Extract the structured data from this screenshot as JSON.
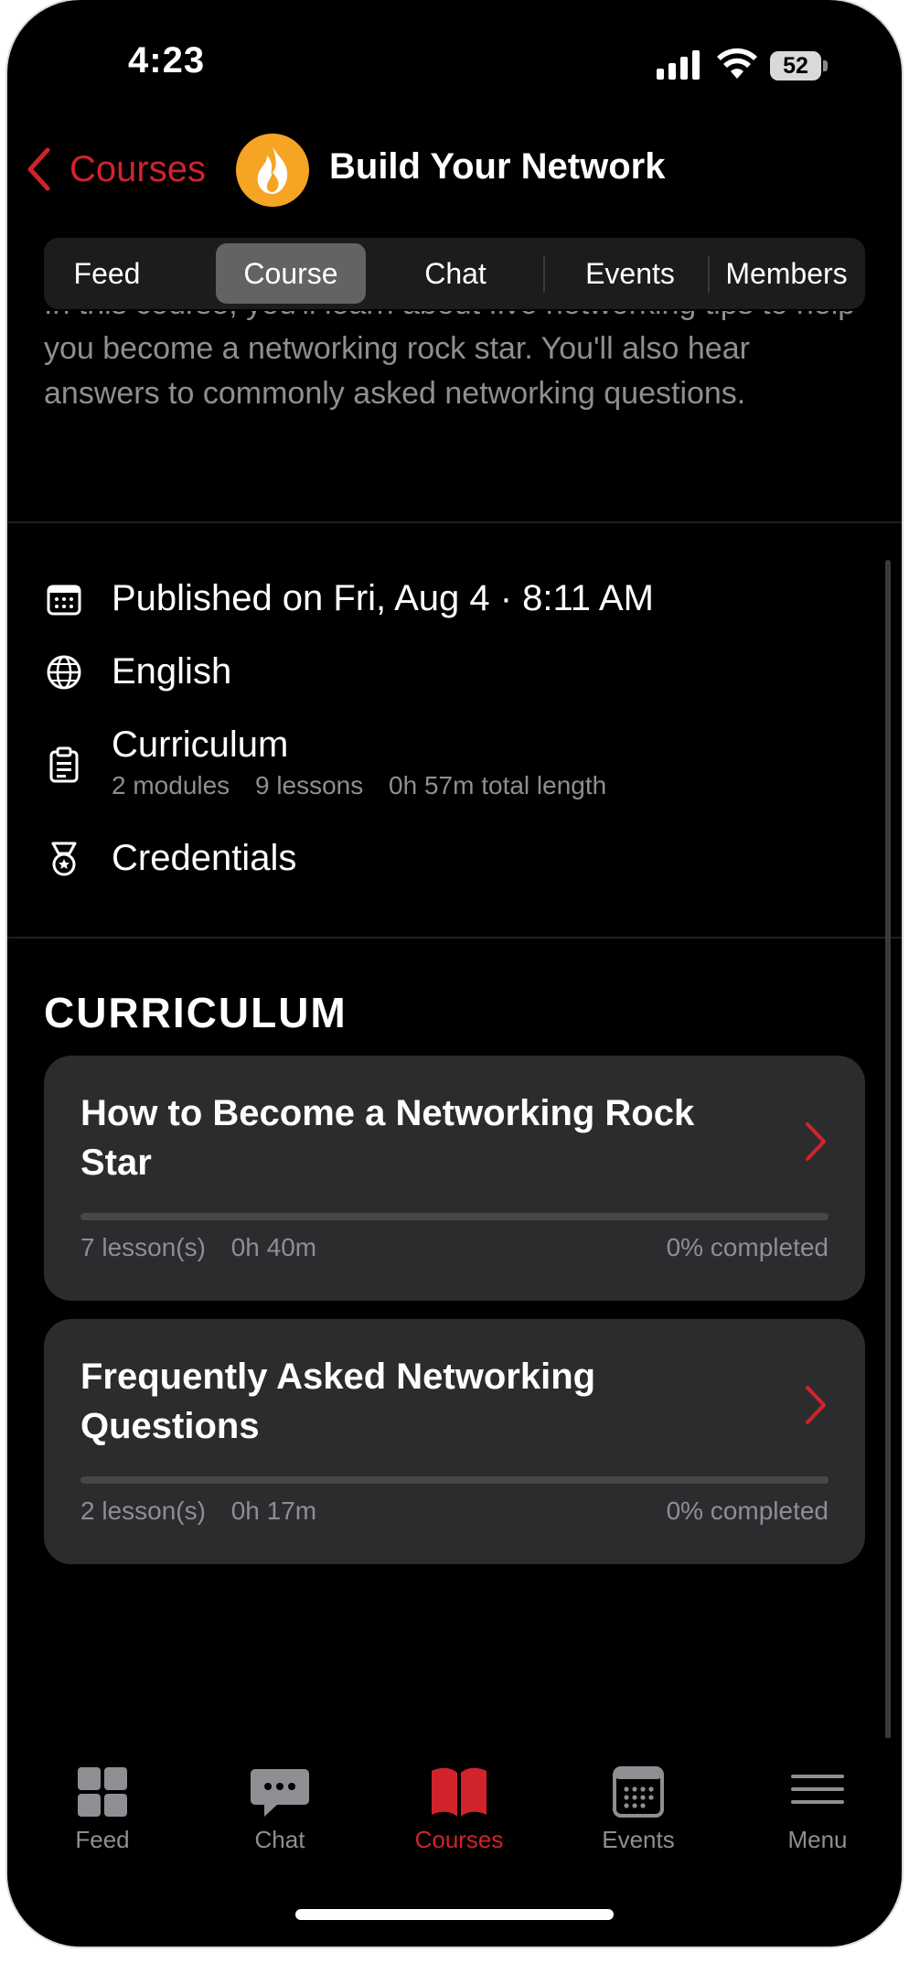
{
  "status_bar": {
    "time": "4:23",
    "battery": "52"
  },
  "nav": {
    "back_label": "Courses",
    "title": "Build Your Network"
  },
  "segments": [
    {
      "label": "Feed"
    },
    {
      "label": "Course",
      "active": true
    },
    {
      "label": "Chat"
    },
    {
      "label": "Events"
    },
    {
      "label": "Members"
    }
  ],
  "description": "In this course, you'll learn about five networking tips to help you become a networking rock star. You'll also hear answers to commonly asked networking questions.",
  "meta": {
    "published": "Published on Fri, Aug 4 · 8:11 AM",
    "language": "English",
    "curriculum_label": "Curriculum",
    "modules": "2 modules",
    "lessons": "9 lessons",
    "length": "0h 57m total length",
    "credentials": "Credentials"
  },
  "curriculum": {
    "heading": "CURRICULUM",
    "modules": [
      {
        "title": "How to Become a Networking Rock Star",
        "lessons": "7 lesson(s)",
        "duration": "0h 40m",
        "completed": "0% completed",
        "progress": 0
      },
      {
        "title": "Frequently Asked Networking Questions",
        "lessons": "2 lesson(s)",
        "duration": "0h 17m",
        "completed": "0% completed",
        "progress": 0
      }
    ]
  },
  "tabbar": [
    {
      "label": "Feed",
      "icon": "grid-icon"
    },
    {
      "label": "Chat",
      "icon": "chat-bubble-icon"
    },
    {
      "label": "Courses",
      "icon": "book-icon",
      "active": true
    },
    {
      "label": "Events",
      "icon": "calendar-icon"
    },
    {
      "label": "Menu",
      "icon": "hamburger-icon"
    }
  ],
  "colors": {
    "accent": "#d0232b",
    "background": "#000000",
    "card": "#2c2c2e",
    "secondary_text": "#8e8e93",
    "avatar": "#f6a423"
  }
}
